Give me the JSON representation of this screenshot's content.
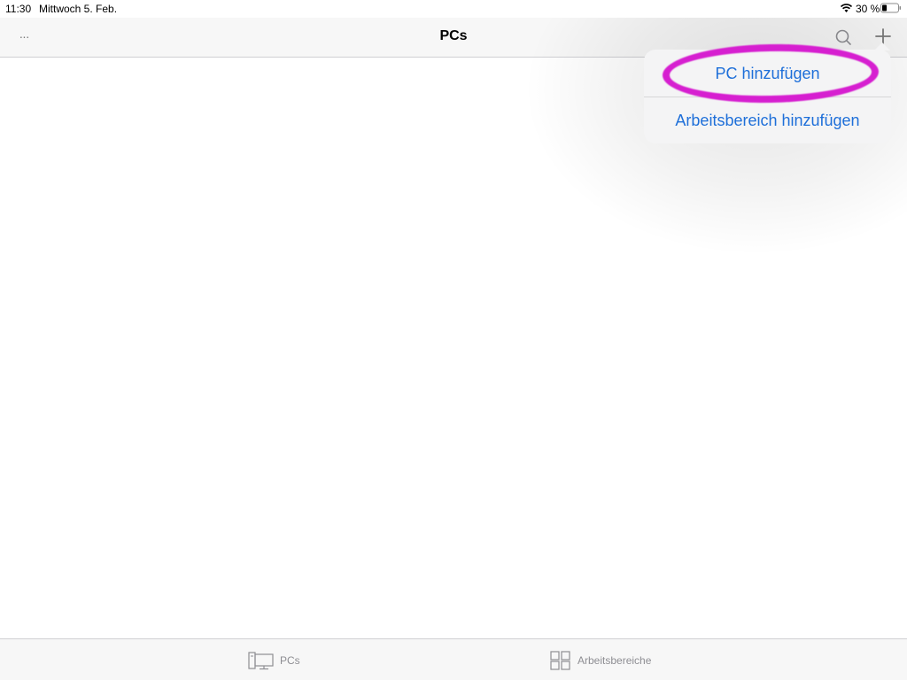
{
  "status_bar": {
    "time": "11:30",
    "date": "Mittwoch 5. Feb.",
    "battery_percent": "30 %",
    "battery_level": 0.3
  },
  "nav": {
    "title": "PCs",
    "more_label": "···",
    "search_icon": "search-icon",
    "add_icon": "plus-icon"
  },
  "add_menu": {
    "items": [
      {
        "label": "PC hinzufügen"
      },
      {
        "label": "Arbeitsbereich hinzufügen"
      }
    ]
  },
  "tab_bar": {
    "tabs": [
      {
        "label": "PCs",
        "icon": "pc-monitor-icon"
      },
      {
        "label": "Arbeitsbereiche",
        "icon": "workspaces-grid-icon"
      }
    ]
  },
  "colors": {
    "accent": "#1e6fd9",
    "annotation": "#d61fd0",
    "inactive": "#8e8e93"
  }
}
